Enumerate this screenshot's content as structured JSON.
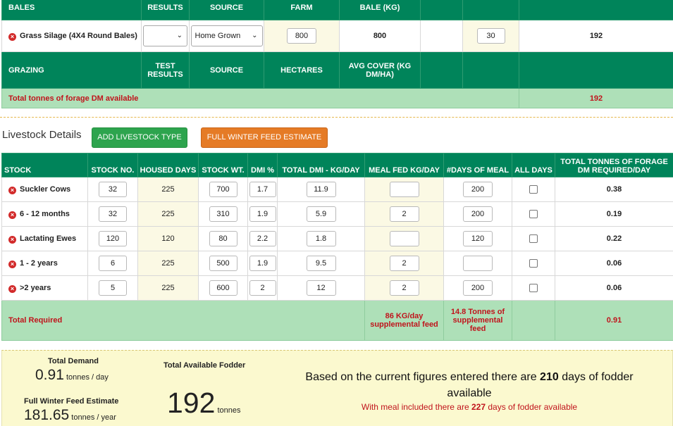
{
  "forage": {
    "header_top": [
      "BALES",
      "RESULTS",
      "SOURCE",
      "FARM",
      "BALE (KG)",
      "",
      "",
      ""
    ],
    "bale_row": {
      "name": "Grass Silage (4X4 Round Bales)",
      "test_result": "",
      "source": "Home Grown",
      "farm_value": "800",
      "bale_kg": "800",
      "empty": "",
      "count_value": "30",
      "tonnes": "192"
    },
    "grazing_header": {
      "label": "GRAZING",
      "test_results": "TEST RESULTS",
      "source": "SOURCE",
      "hectares": "HECTARES",
      "avg_cover": "AVG COVER (KG DM/HA)"
    },
    "total_row": {
      "label": "Total tonnes of forage DM available",
      "value": "192"
    }
  },
  "livestock": {
    "title": "Livestock Details",
    "add_button": "ADD LIVESTOCK TYPE",
    "estimate_button": "FULL WINTER FEED ESTIMATE",
    "headers": [
      "STOCK",
      "STOCK NO.",
      "HOUSED DAYS",
      "STOCK WT.",
      "DMI %",
      "TOTAL DMI - KG/DAY",
      "MEAL FED KG/DAY",
      "#DAYS OF MEAL",
      "ALL DAYS",
      "TOTAL TONNES OF FORAGE DM REQUIRED/DAY"
    ],
    "rows": [
      {
        "stock": "Suckler Cows",
        "stock_no": "32",
        "housed_days": "225",
        "stock_wt": "700",
        "dmi": "1.7",
        "total_dmi": "11.9",
        "meal_fed": "",
        "days_meal": "200",
        "tonnes": "0.38"
      },
      {
        "stock": "6 - 12 months",
        "stock_no": "32",
        "housed_days": "225",
        "stock_wt": "310",
        "dmi": "1.9",
        "total_dmi": "5.9",
        "meal_fed": "2",
        "days_meal": "200",
        "tonnes": "0.19"
      },
      {
        "stock": "Lactating Ewes",
        "stock_no": "120",
        "housed_days": "120",
        "stock_wt": "80",
        "dmi": "2.2",
        "total_dmi": "1.8",
        "meal_fed": "",
        "days_meal": "120",
        "tonnes": "0.22"
      },
      {
        "stock": "1 - 2 years",
        "stock_no": "6",
        "housed_days": "225",
        "stock_wt": "500",
        "dmi": "1.9",
        "total_dmi": "9.5",
        "meal_fed": "2",
        "days_meal": "",
        "tonnes": "0.06"
      },
      {
        "stock": ">2 years",
        "stock_no": "5",
        "housed_days": "225",
        "stock_wt": "600",
        "dmi": "2",
        "total_dmi": "12",
        "meal_fed": "2",
        "days_meal": "200",
        "tonnes": "0.06"
      }
    ],
    "total": {
      "label": "Total Required",
      "meal_feed": "86 KG/day supplemental feed",
      "meal_tonnes": "14.8 Tonnes of supplemental feed",
      "value": "0.91"
    }
  },
  "summary": {
    "total_demand_label": "Total Demand",
    "total_demand_value": "0.91",
    "total_demand_unit": "tonnes / day",
    "winter_label": "Full Winter Feed Estimate",
    "winter_value": "181.65",
    "winter_unit": "tonnes / year",
    "fodder_label": "Total Available Fodder",
    "fodder_value": "192",
    "fodder_unit": "tonnes",
    "message_pre": "Based on the current figures entered there are",
    "message_days": "210",
    "message_post": "days of fodder available",
    "meal_pre": "With meal included there are",
    "meal_days": "227",
    "meal_post": "days of fodder available"
  }
}
